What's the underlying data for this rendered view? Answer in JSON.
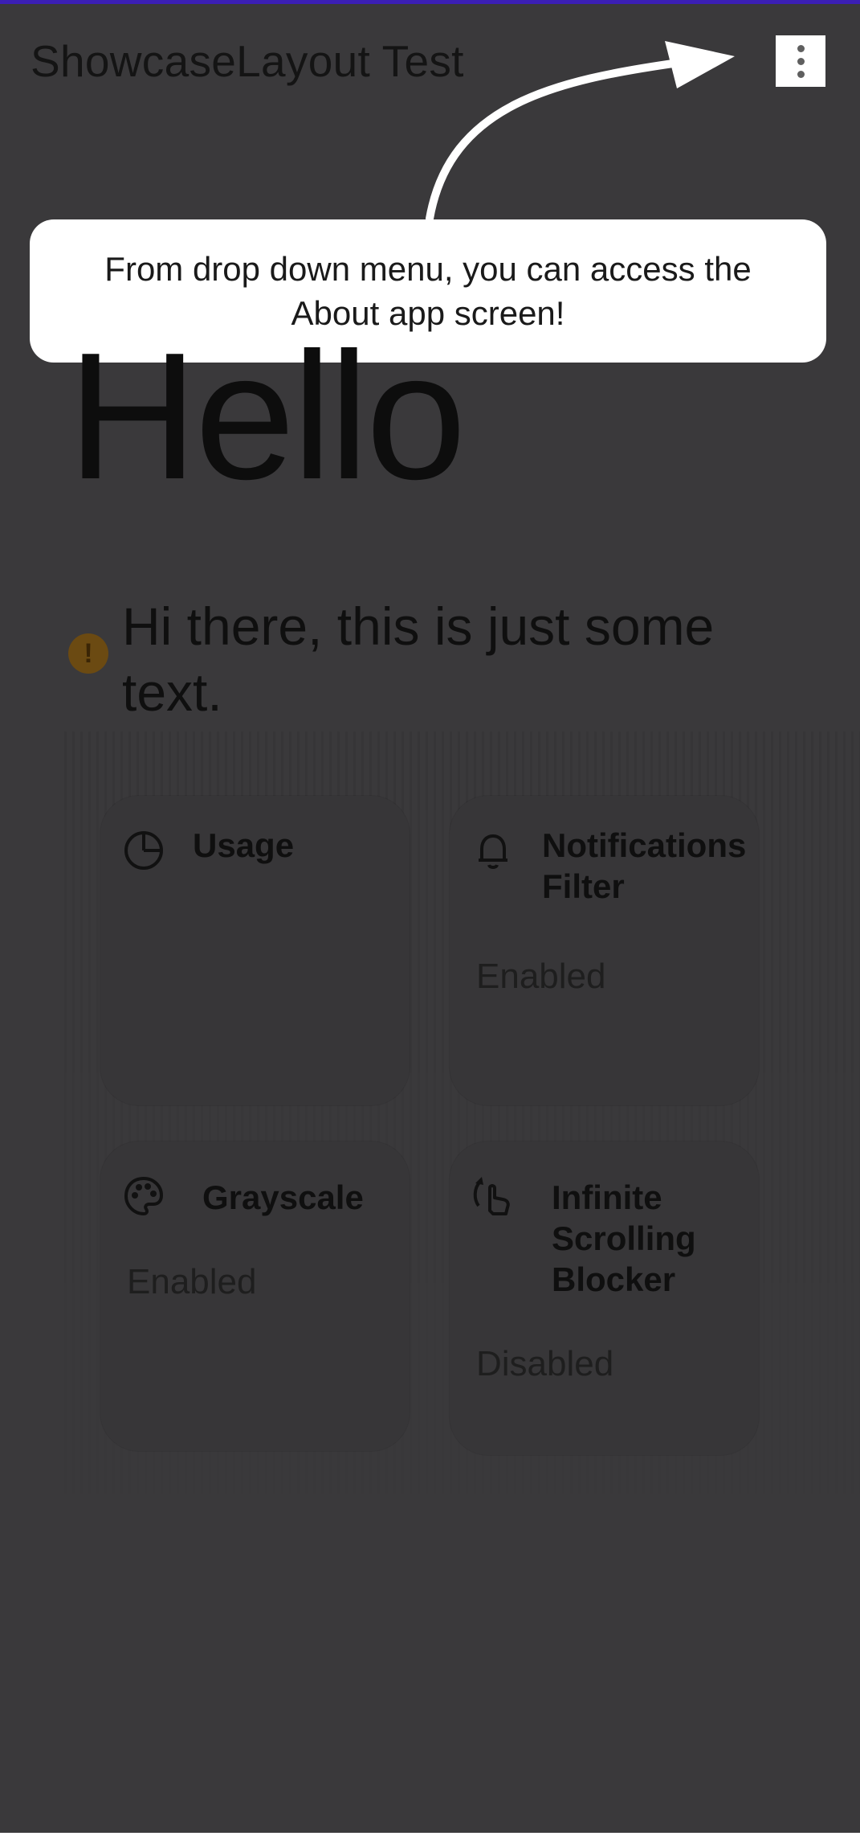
{
  "toolbar": {
    "title": "ShowcaseLayout Test",
    "menu_icon": "more-vert-icon"
  },
  "tooltip": {
    "text": "From drop down menu, you can access the About app screen!"
  },
  "main": {
    "hello": "Hello",
    "intro": "Hi there, this is just some text.",
    "warning_icon": "warning-icon"
  },
  "cards": [
    {
      "title": "Usage",
      "icon": "pie-chart-icon",
      "status": ""
    },
    {
      "title": "Notifications Filter",
      "icon": "bell-icon",
      "status": "Enabled"
    },
    {
      "title": "Grayscale",
      "icon": "palette-icon",
      "status": "Enabled"
    },
    {
      "title": "Infinite Scrolling Blocker",
      "icon": "swipe-icon",
      "status": "Disabled"
    }
  ],
  "colors": {
    "accent_bar": "#3b1fb4",
    "overlay": "#3a393b",
    "tooltip_bg": "#ffffff",
    "warning": "#6b4a12"
  }
}
